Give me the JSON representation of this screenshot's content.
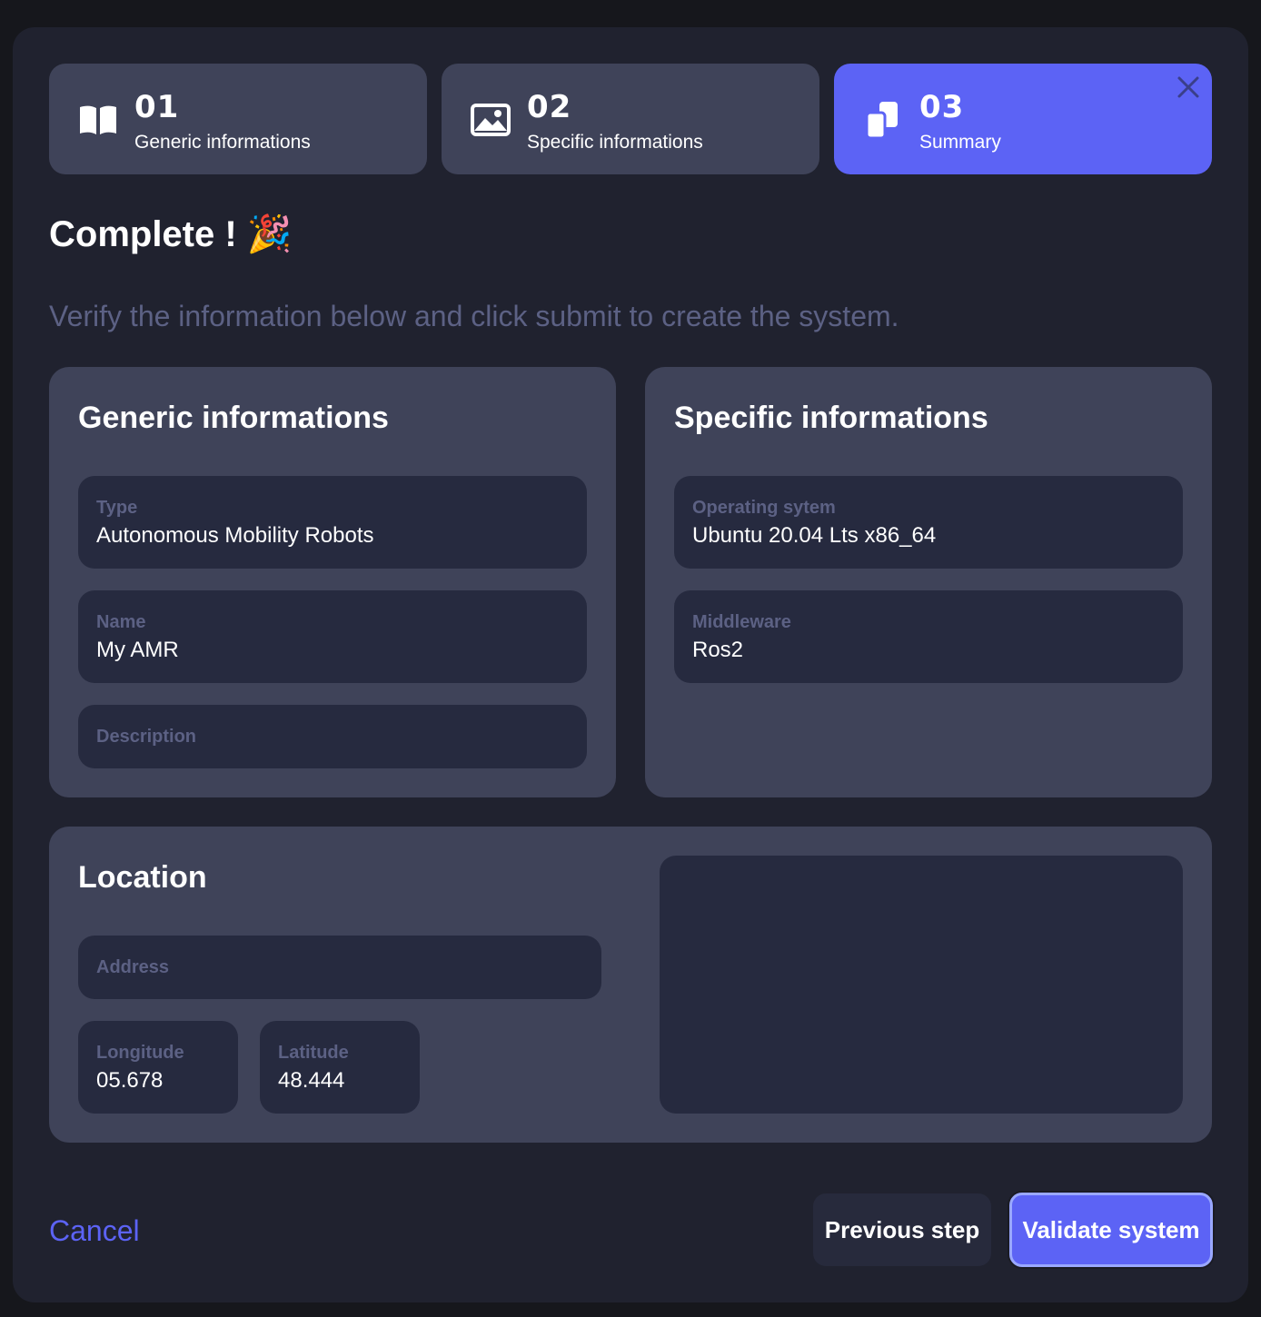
{
  "steps": [
    {
      "number": "01",
      "label": "Generic informations",
      "icon": "book-open-icon"
    },
    {
      "number": "02",
      "label": "Specific informations",
      "icon": "image-icon"
    },
    {
      "number": "03",
      "label": "Summary",
      "icon": "copy-icon",
      "active": true
    }
  ],
  "header": {
    "title": "Complete ! 🎉",
    "subtitle": "Verify the information below and click submit to create the system."
  },
  "generic": {
    "title": "Generic informations",
    "type_label": "Type",
    "type_value": "Autonomous Mobility Robots",
    "name_label": "Name",
    "name_value": "My AMR",
    "description_label": "Description"
  },
  "specific": {
    "title": "Specific informations",
    "os_label": "Operating sytem",
    "os_value": "Ubuntu 20.04 Lts x86_64",
    "middleware_label": "Middleware",
    "middleware_value": "Ros2"
  },
  "location": {
    "title": "Location",
    "address_label": "Address",
    "longitude_label": "Longitude",
    "longitude_value": "05.678",
    "latitude_label": "Latitude",
    "latitude_value": "48.444"
  },
  "footer": {
    "cancel_label": "Cancel",
    "previous_label": "Previous step",
    "validate_label": "Validate system"
  },
  "colors": {
    "accent": "#5c63f5",
    "card": "#3f4359",
    "field": "#262a3f",
    "muted": "#5c6184"
  }
}
